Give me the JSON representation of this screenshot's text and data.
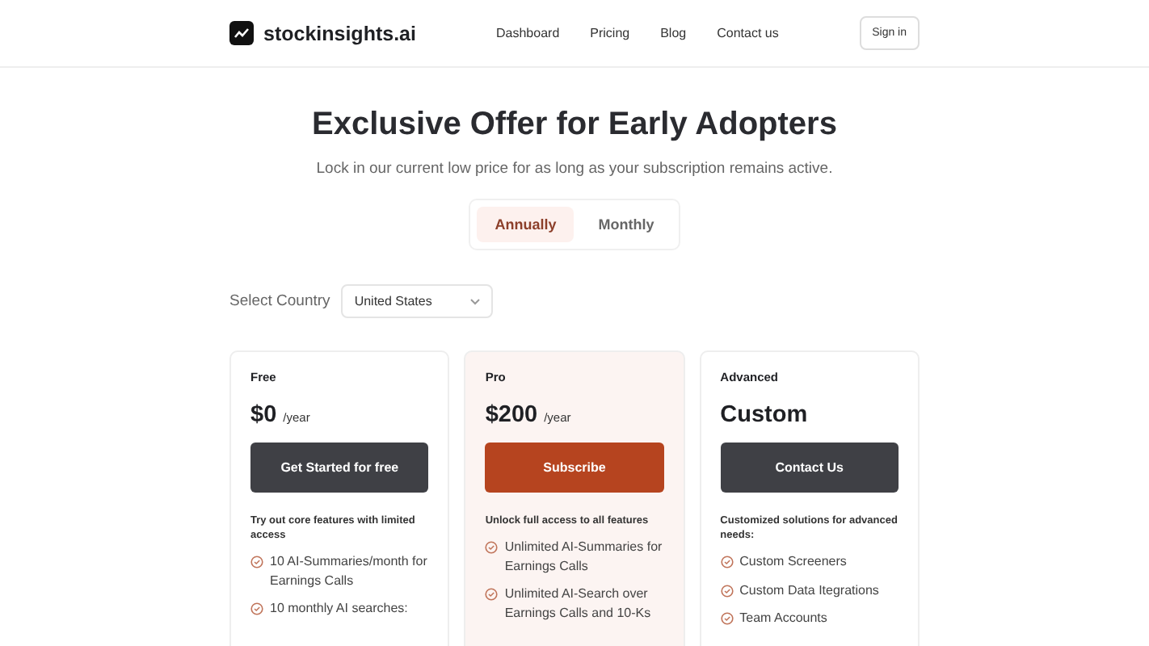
{
  "header": {
    "brand": "stockinsights.ai",
    "nav": [
      "Dashboard",
      "Pricing",
      "Blog",
      "Contact us"
    ],
    "sign_in": "Sign in"
  },
  "hero": {
    "title": "Exclusive Offer for Early Adopters",
    "subtitle": "Lock in our current low price for as long as your subscription remains active."
  },
  "billing_tabs": [
    {
      "label": "Annually",
      "selected": true
    },
    {
      "label": "Monthly",
      "selected": false
    }
  ],
  "country": {
    "label": "Select Country",
    "value": "United States"
  },
  "plans": [
    {
      "name": "Free",
      "price": "$0",
      "period": "/year",
      "button": "Get Started for free",
      "highlighted": false,
      "description": "Try out core features with limited access",
      "features": [
        "10 AI-Summaries/month for Earnings Calls",
        "10 monthly AI searches:"
      ]
    },
    {
      "name": "Pro",
      "price": "$200",
      "period": "/year",
      "button": "Subscribe",
      "highlighted": true,
      "description": "Unlock full access to all features",
      "features": [
        "Unlimited AI-Summaries for Earnings Calls",
        "Unlimited AI-Search over Earnings Calls and 10-Ks"
      ]
    },
    {
      "name": "Advanced",
      "price": "Custom",
      "button": "Contact Us",
      "highlighted": false,
      "description": "Customized solutions for advanced needs:",
      "features": [
        "Custom Screeners",
        "Custom Data Itegrations",
        "Team Accounts"
      ]
    }
  ]
}
